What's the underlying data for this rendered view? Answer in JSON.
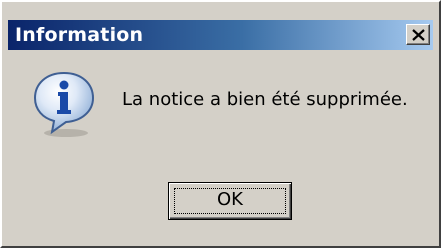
{
  "dialog": {
    "title": "Information",
    "message": "La notice a bien été supprimée.",
    "ok_label": "OK",
    "icon": "information-icon",
    "close_icon": "close-icon"
  },
  "colors": {
    "titlebar_start": "#0a246a",
    "titlebar_end": "#a6caf0",
    "face": "#d4d0c8"
  }
}
